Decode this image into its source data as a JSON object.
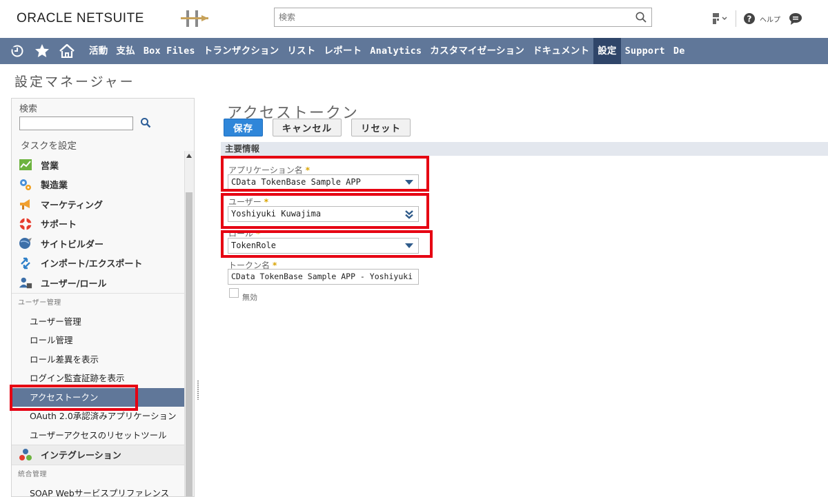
{
  "header": {
    "logo_text": "ORACLE NETSUITE",
    "search_placeholder": "検索",
    "help_label": "ヘルプ"
  },
  "nav": {
    "items": [
      {
        "label": "活動"
      },
      {
        "label": "支払"
      },
      {
        "label": "Box Files"
      },
      {
        "label": "トランザクション"
      },
      {
        "label": "リスト"
      },
      {
        "label": "レポート"
      },
      {
        "label": "Analytics"
      },
      {
        "label": "カスタマイゼーション"
      },
      {
        "label": "ドキュメント"
      },
      {
        "label": "設定",
        "active": true
      },
      {
        "label": "Support"
      },
      {
        "label": "De"
      }
    ]
  },
  "page": {
    "title": "設定マネージャー"
  },
  "sidebar": {
    "search_label": "検索",
    "task_label": "タスクを設定",
    "groups": [
      {
        "label": "営業",
        "icon": "chart-icon"
      },
      {
        "label": "製造業",
        "icon": "gears-icon"
      },
      {
        "label": "マーケティング",
        "icon": "megaphone-icon"
      },
      {
        "label": "サポート",
        "icon": "lifebuoy-icon"
      },
      {
        "label": "サイトビルダー",
        "icon": "globe-icon"
      },
      {
        "label": "インポート/エクスポート",
        "icon": "import-export-icon"
      },
      {
        "label": "ユーザー/ロール",
        "icon": "users-icon"
      }
    ],
    "section_user_mgmt": "ユーザー管理",
    "items": [
      {
        "label": "ユーザー管理"
      },
      {
        "label": "ロール管理"
      },
      {
        "label": "ロール差異を表示"
      },
      {
        "label": "ログイン監査証跡を表示"
      },
      {
        "label": "アクセストークン",
        "active": true
      },
      {
        "label": "OAuth 2.0承認済みアプリケーション"
      },
      {
        "label": "ユーザーアクセスのリセットツール"
      }
    ],
    "integration_label": "インテグレーション",
    "section_integration_mgmt": "統合管理",
    "partial_item": "SOAP Webサービスプリファレンス"
  },
  "form": {
    "title": "アクセストークン",
    "buttons": {
      "save": "保存",
      "cancel": "キャンセル",
      "reset": "リセット"
    },
    "section": "主要情報",
    "fields": {
      "application": {
        "label": "アプリケーション名",
        "value": "CData TokenBase Sample APP"
      },
      "user": {
        "label": "ユーザー",
        "value": "Yoshiyuki Kuwajima"
      },
      "role": {
        "label": "ロール",
        "value": "TokenRole"
      },
      "token_name": {
        "label": "トークン名",
        "value": "CData TokenBase Sample APP - Yoshiyuki"
      },
      "inactive": {
        "label": "無効",
        "checked": false
      }
    },
    "required_mark": "*"
  },
  "colors": {
    "nav_bg": "#607799",
    "nav_active": "#2f4569",
    "primary_button": "#2f86d9",
    "highlight": "#e60012",
    "required": "#d9a300"
  }
}
